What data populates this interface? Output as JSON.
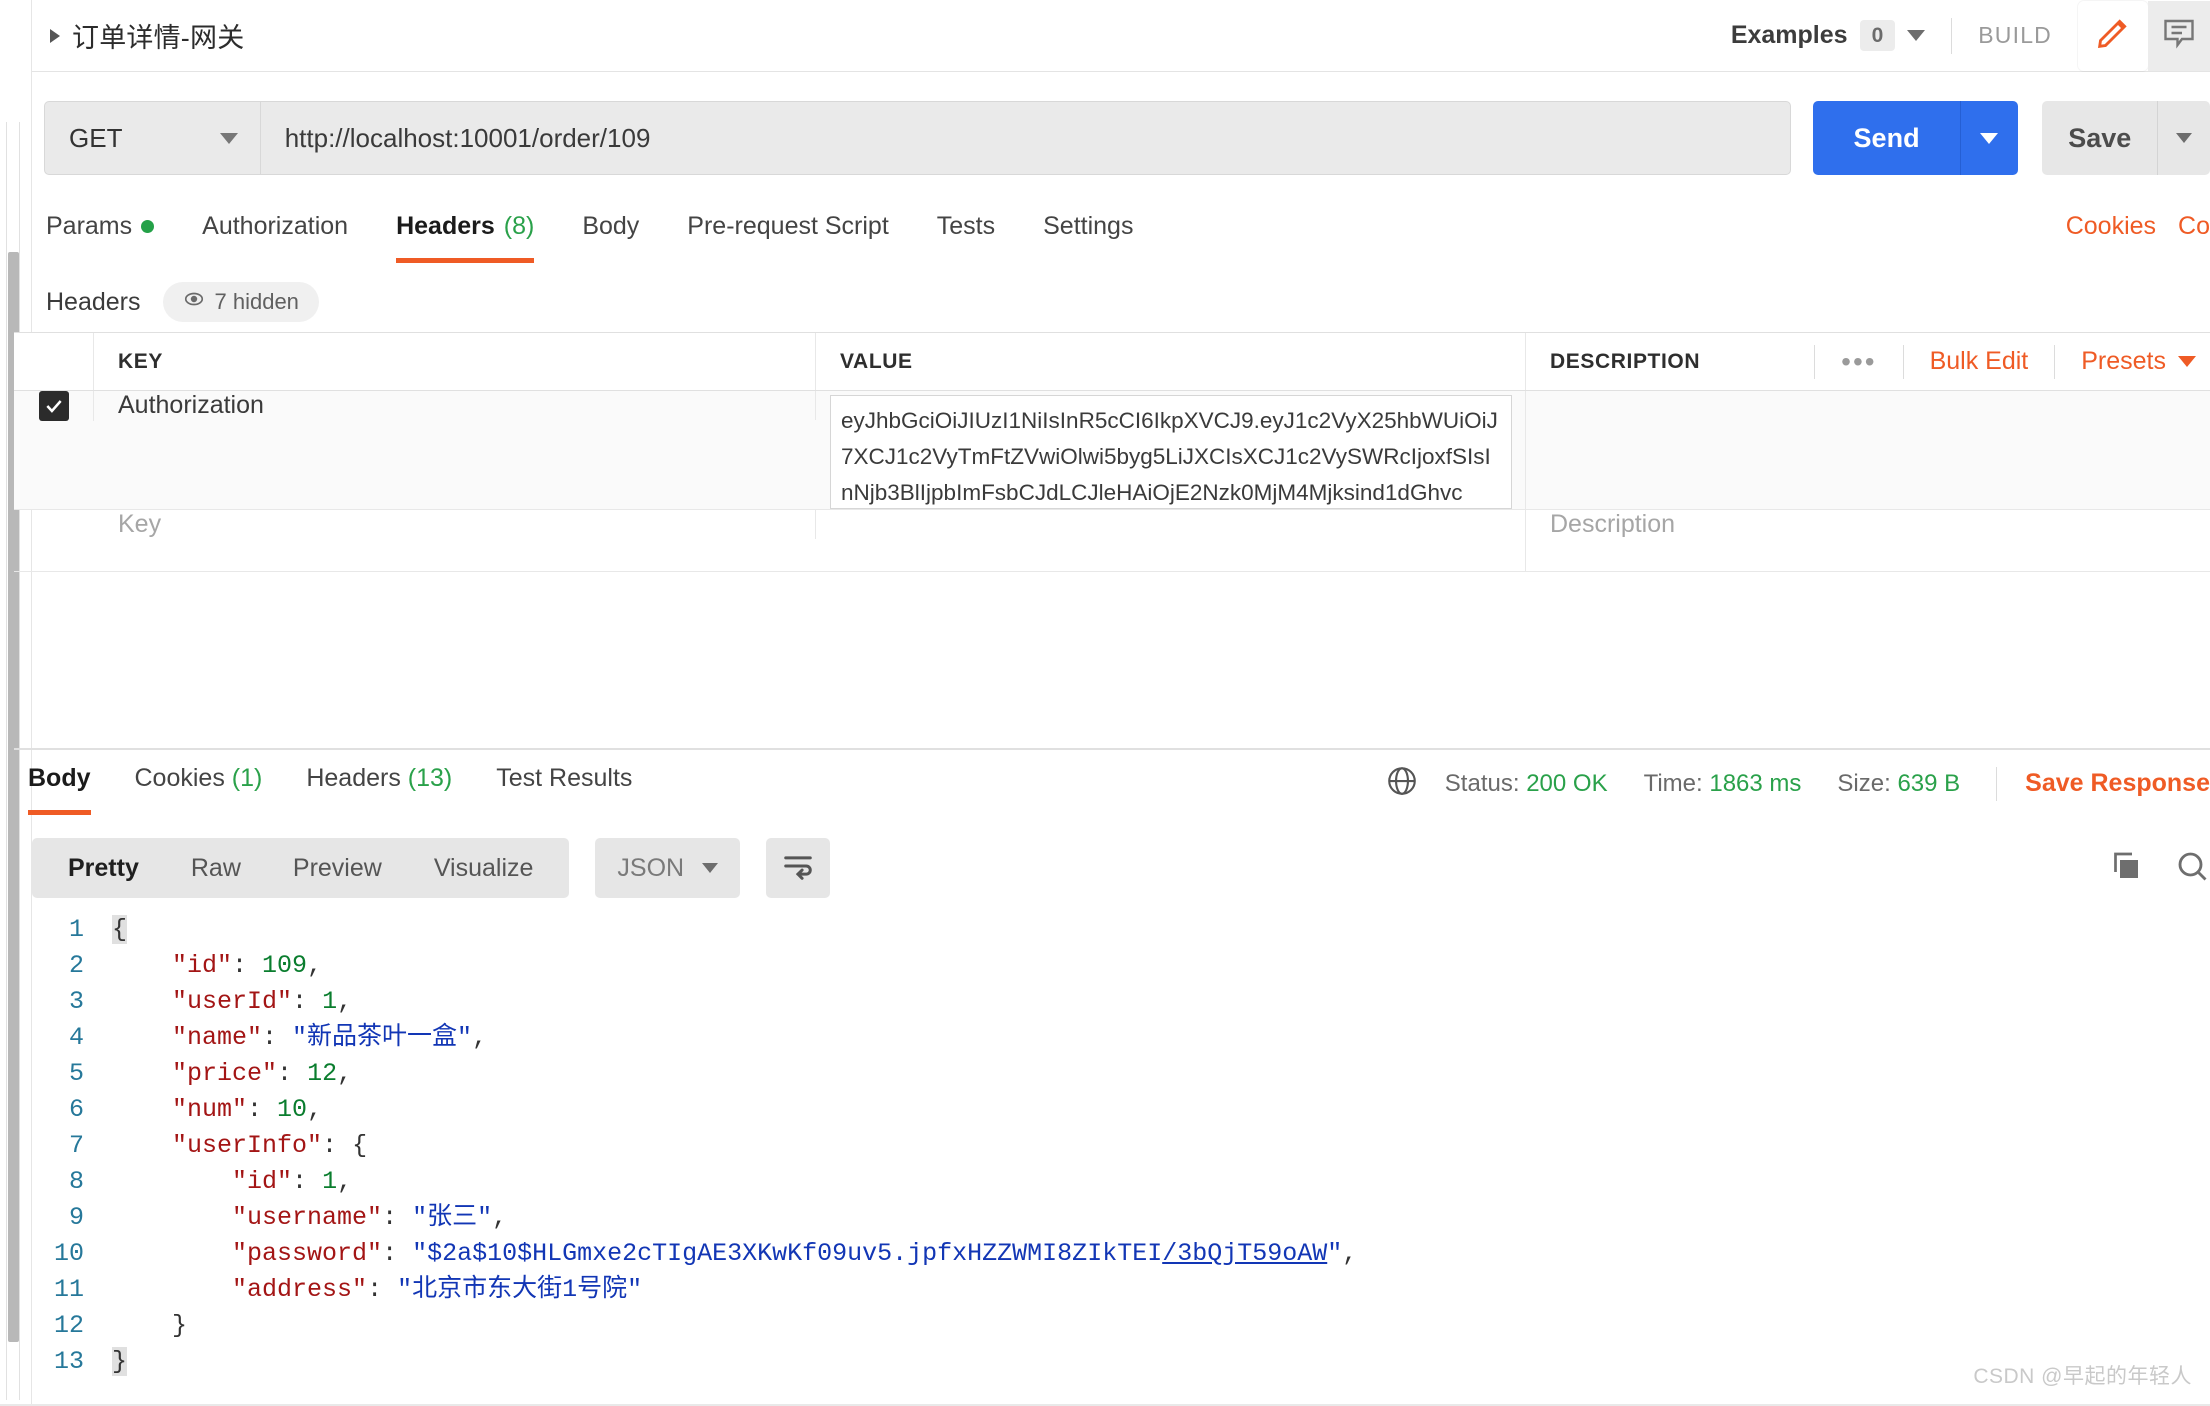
{
  "request": {
    "title": "订单详情-网关",
    "method": "GET",
    "url": "http://localhost:10001/order/109",
    "send_label": "Send",
    "save_label": "Save",
    "examples_label": "Examples",
    "examples_count": "0",
    "build_label": "BUILD"
  },
  "tabs": [
    {
      "label": "Params",
      "dot": true,
      "active": false
    },
    {
      "label": "Authorization",
      "active": false
    },
    {
      "label": "Headers",
      "count": "(8)",
      "active": true
    },
    {
      "label": "Body",
      "active": false
    },
    {
      "label": "Pre-request Script",
      "active": false
    },
    {
      "label": "Tests",
      "active": false
    },
    {
      "label": "Settings",
      "active": false
    }
  ],
  "tabs_right": [
    {
      "label": "Cookies"
    },
    {
      "label": "Co"
    }
  ],
  "headers_section": {
    "label": "Headers",
    "hidden_pill": "7 hidden",
    "columns": {
      "key": "KEY",
      "value": "VALUE",
      "description": "DESCRIPTION"
    },
    "actions": {
      "bulk_edit": "Bulk Edit",
      "presets": "Presets"
    },
    "rows": [
      {
        "checked": true,
        "key": "Authorization",
        "value": "eyJhbGciOiJIUzI1NiIsInR5cCI6IkpXVCJ9.eyJ1c2VyX25hbWUiOiJ7XCJ1c2VyTmFtZVwiOlwi5byg5LiJXCIsXCJ1c2VySWRcIjoxfSIsInNjb3BlIjpbImFsbCJdLCJleHAiOjE2Nzk0MjM4Mjksind1dGhvc",
        "description": ""
      },
      {
        "checked": false,
        "key_placeholder": "Key",
        "value": "",
        "description_placeholder": "Description"
      }
    ]
  },
  "response": {
    "tabs": [
      {
        "label": "Body",
        "active": true
      },
      {
        "label": "Cookies",
        "count": "(1)",
        "active": false
      },
      {
        "label": "Headers",
        "count": "(13)",
        "active": false
      },
      {
        "label": "Test Results",
        "active": false
      }
    ],
    "status_label": "Status:",
    "status_value": "200 OK",
    "time_label": "Time:",
    "time_value": "1863 ms",
    "size_label": "Size:",
    "size_value": "639 B",
    "save_response": "Save Response",
    "view_modes": [
      {
        "label": "Pretty",
        "active": true
      },
      {
        "label": "Raw",
        "active": false
      },
      {
        "label": "Preview",
        "active": false
      },
      {
        "label": "Visualize",
        "active": false
      }
    ],
    "format": "JSON",
    "body_lines": [
      {
        "no": "1",
        "indent": 0,
        "tokens": [
          {
            "t": "{",
            "c": "brace-hl p"
          }
        ]
      },
      {
        "no": "2",
        "indent": 1,
        "tokens": [
          {
            "t": "\"id\"",
            "c": "k"
          },
          {
            "t": ": ",
            "c": "p"
          },
          {
            "t": "109",
            "c": "n"
          },
          {
            "t": ",",
            "c": "p"
          }
        ]
      },
      {
        "no": "3",
        "indent": 1,
        "tokens": [
          {
            "t": "\"userId\"",
            "c": "k"
          },
          {
            "t": ": ",
            "c": "p"
          },
          {
            "t": "1",
            "c": "n"
          },
          {
            "t": ",",
            "c": "p"
          }
        ]
      },
      {
        "no": "4",
        "indent": 1,
        "tokens": [
          {
            "t": "\"name\"",
            "c": "k"
          },
          {
            "t": ": ",
            "c": "p"
          },
          {
            "t": "\"新品茶叶一盒\"",
            "c": "s"
          },
          {
            "t": ",",
            "c": "p"
          }
        ]
      },
      {
        "no": "5",
        "indent": 1,
        "tokens": [
          {
            "t": "\"price\"",
            "c": "k"
          },
          {
            "t": ": ",
            "c": "p"
          },
          {
            "t": "12",
            "c": "n"
          },
          {
            "t": ",",
            "c": "p"
          }
        ]
      },
      {
        "no": "6",
        "indent": 1,
        "tokens": [
          {
            "t": "\"num\"",
            "c": "k"
          },
          {
            "t": ": ",
            "c": "p"
          },
          {
            "t": "10",
            "c": "n"
          },
          {
            "t": ",",
            "c": "p"
          }
        ]
      },
      {
        "no": "7",
        "indent": 1,
        "tokens": [
          {
            "t": "\"userInfo\"",
            "c": "k"
          },
          {
            "t": ": ",
            "c": "p"
          },
          {
            "t": "{",
            "c": "p"
          }
        ]
      },
      {
        "no": "8",
        "indent": 2,
        "tokens": [
          {
            "t": "\"id\"",
            "c": "k"
          },
          {
            "t": ": ",
            "c": "p"
          },
          {
            "t": "1",
            "c": "n"
          },
          {
            "t": ",",
            "c": "p"
          }
        ]
      },
      {
        "no": "9",
        "indent": 2,
        "tokens": [
          {
            "t": "\"username\"",
            "c": "k"
          },
          {
            "t": ": ",
            "c": "p"
          },
          {
            "t": "\"张三\"",
            "c": "s"
          },
          {
            "t": ",",
            "c": "p"
          }
        ]
      },
      {
        "no": "10",
        "indent": 2,
        "tokens": [
          {
            "t": "\"password\"",
            "c": "k"
          },
          {
            "t": ": ",
            "c": "p"
          },
          {
            "t": "\"$2a$10$HLGmxe2cTIgAE3XKwKf09uv5.jpfxHZZWMI8ZIkTEI",
            "c": "s"
          },
          {
            "t": "/3bQjT59oAW",
            "c": "s u"
          },
          {
            "t": "\"",
            "c": "s"
          },
          {
            "t": ",",
            "c": "p"
          }
        ]
      },
      {
        "no": "11",
        "indent": 2,
        "tokens": [
          {
            "t": "\"address\"",
            "c": "k"
          },
          {
            "t": ": ",
            "c": "p"
          },
          {
            "t": "\"北京市东大街1号院\"",
            "c": "s"
          }
        ]
      },
      {
        "no": "12",
        "indent": 1,
        "tokens": [
          {
            "t": "}",
            "c": "p"
          }
        ]
      },
      {
        "no": "13",
        "indent": 0,
        "tokens": [
          {
            "t": "}",
            "c": "brace-hl p"
          }
        ]
      }
    ]
  },
  "watermark": "CSDN @早起的年轻人"
}
